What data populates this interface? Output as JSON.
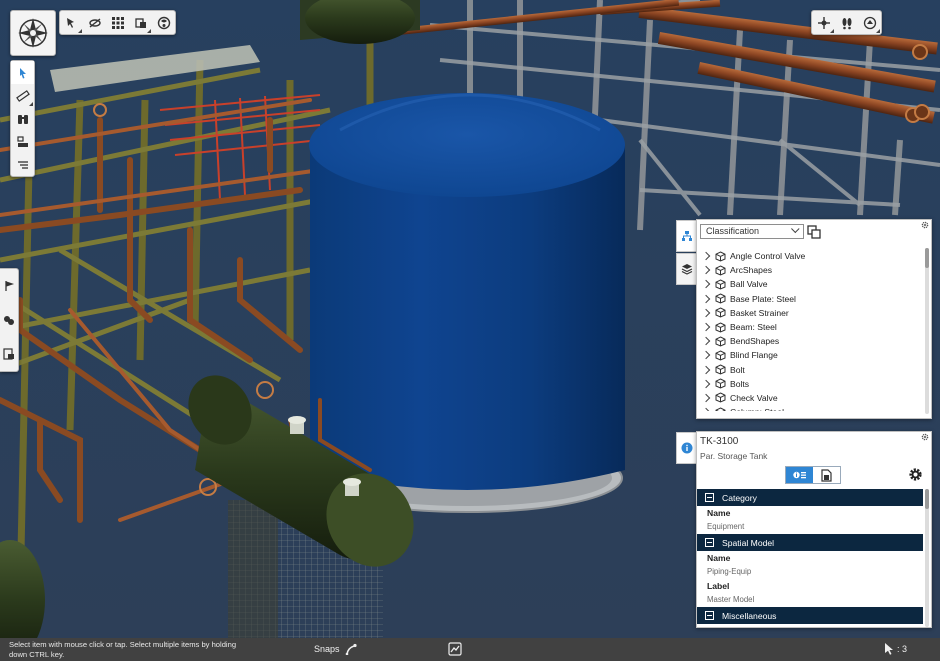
{
  "viewport": {
    "object_label": "3D plant model view"
  },
  "top_toolbar": {
    "logo": "compass-logo-icon",
    "buttons": [
      {
        "icon": "select-tool-icon"
      },
      {
        "icon": "hide-icon"
      },
      {
        "icon": "grid-icon"
      },
      {
        "icon": "section-icon"
      },
      {
        "icon": "render-mode-icon"
      }
    ]
  },
  "left_toolbar": {
    "buttons": [
      {
        "icon": "pointer-icon"
      },
      {
        "icon": "measure-icon"
      },
      {
        "icon": "binoculars-icon"
      },
      {
        "icon": "clip-icon"
      },
      {
        "icon": "markup-icon"
      }
    ]
  },
  "left_side_toolbar": {
    "buttons": [
      {
        "icon": "flag-icon"
      },
      {
        "icon": "visibility-icon"
      },
      {
        "icon": "report-icon"
      }
    ]
  },
  "top_right_toolbar": {
    "buttons": [
      {
        "icon": "fly-icon"
      },
      {
        "icon": "walk-icon"
      },
      {
        "icon": "orbit-icon"
      }
    ]
  },
  "tree_panel": {
    "dropdown_value": "Classification",
    "items": [
      "Angle Control Valve",
      "ArcShapes",
      "Ball Valve",
      "Base Plate: Steel",
      "Basket Strainer",
      "Beam: Steel",
      "BendShapes",
      "Blind Flange",
      "Bolt",
      "Bolts",
      "Check Valve",
      "Column: Steel"
    ]
  },
  "properties_panel": {
    "title": "TK-3100",
    "subtitle": "Par. Storage Tank",
    "sections": [
      {
        "name": "Category",
        "props": [
          {
            "label": "Name",
            "value": "Equipment"
          }
        ]
      },
      {
        "name": "Spatial Model",
        "props": [
          {
            "label": "Name",
            "value": "Piping-Equip"
          },
          {
            "label": "Label",
            "value": "Master Model"
          }
        ]
      },
      {
        "name": "Miscellaneous",
        "props": []
      }
    ]
  },
  "statusbar": {
    "message": "Select item with mouse click or tap. Select multiple items by holding down CTRL key.",
    "snaps_label": "Snaps",
    "selection_count": ": 3"
  },
  "colors": {
    "tank": "#0d3f80",
    "sky": "#2a3c5a",
    "section_header": "#0c2740",
    "accent": "#2f86d4",
    "pipe_rust": "#8a4a22",
    "vessel": "#2c3a1e"
  }
}
